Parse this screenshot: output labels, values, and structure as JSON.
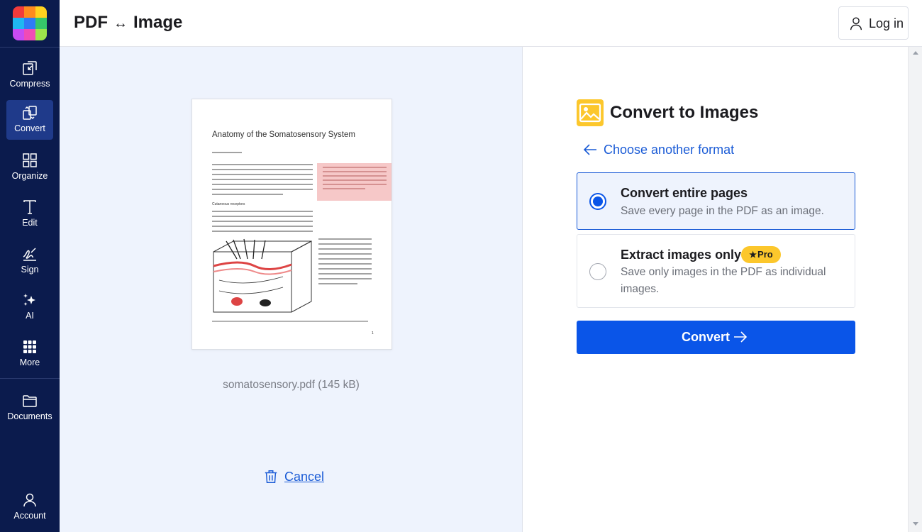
{
  "colors": {
    "sidebar_bg": "#0b1b4d",
    "sidebar_active": "#1f3a8a",
    "accent": "#0a55e8",
    "link": "#1a5bd6",
    "pro_badge": "#fcc72c",
    "preview_bg": "#eef3fd"
  },
  "sidebar": {
    "logo": "app-logo",
    "items": [
      {
        "label": "Compress",
        "icon": "compress-icon"
      },
      {
        "label": "Convert",
        "icon": "convert-icon",
        "active": true
      },
      {
        "label": "Organize",
        "icon": "organize-grid-icon"
      },
      {
        "label": "Edit",
        "icon": "text-t-icon"
      },
      {
        "label": "Sign",
        "icon": "signature-icon"
      },
      {
        "label": "AI",
        "icon": "sparkle-icon"
      },
      {
        "label": "More",
        "icon": "apps-grid-icon"
      },
      {
        "label": "Documents",
        "icon": "folder-icon"
      },
      {
        "label": "Account",
        "icon": "user-icon"
      }
    ]
  },
  "header": {
    "title_left": "PDF",
    "title_arrow": "↔",
    "title_right": "Image",
    "login_label": "Log in"
  },
  "preview": {
    "document": {
      "title": "Anatomy of the Somatosensory System",
      "section_heading": "Cutaneous receptors"
    },
    "file_name": "somatosensory.pdf",
    "file_size": "(145 kB)",
    "cancel_label": "Cancel"
  },
  "panel": {
    "heading": "Convert to Images",
    "back_link": "Choose another format",
    "options": [
      {
        "title": "Convert entire pages",
        "description": "Save every page in the PDF as an image.",
        "selected": true
      },
      {
        "title": "Extract images only",
        "badge": "Pro",
        "description": "Save only images in the PDF as individual images.",
        "selected": false
      }
    ],
    "convert_label": "Convert"
  }
}
